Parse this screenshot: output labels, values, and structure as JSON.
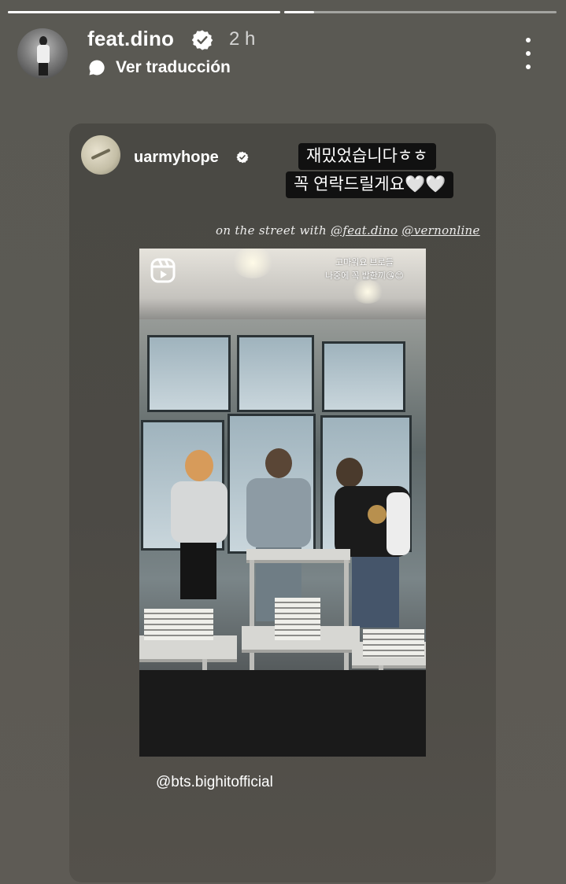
{
  "header": {
    "username": "feat.dino",
    "time": "2 h",
    "translate_label": "Ver traducción"
  },
  "progress": [
    1.0,
    0.11
  ],
  "post": {
    "username": "uarmyhope",
    "stickers": [
      "재밌었습니다ㅎㅎ",
      "꼭 연락드릴게요🤍🤍"
    ],
    "caption_prefix": "on the street with",
    "caption_mention_1": "@feat.dino",
    "caption_mention_2": "@vernonline",
    "photo_caption_line1": "고마워요 브로들",
    "photo_caption_line2": "나중에 꼭 밥한끼😘😊",
    "tag": "@bts.bighitofficial"
  },
  "colors": {
    "background": "#5a5953",
    "card": "#4b4a45",
    "verified": "#ffffff"
  },
  "icons": {
    "verified": "verified-badge-icon",
    "translate": "translate-bubble-icon",
    "more": "more-vertical-icon",
    "reel": "reels-icon"
  }
}
